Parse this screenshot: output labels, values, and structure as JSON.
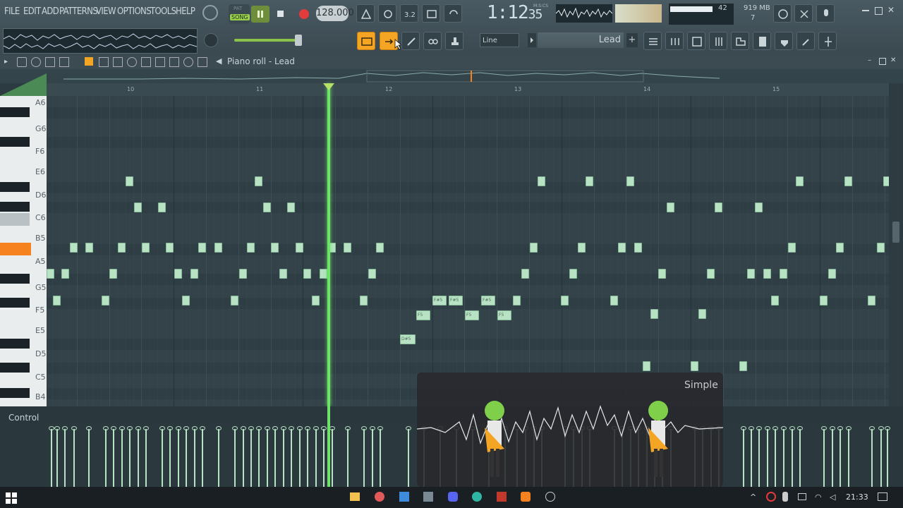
{
  "menu": {
    "items": [
      "FILE",
      "EDIT",
      "ADD",
      "PATTERNS",
      "VIEW",
      "OPTIONS",
      "TOOLS",
      "HELP"
    ]
  },
  "transport": {
    "mode_pat": "PAT",
    "mode_song": "SONG",
    "tempo": "128.000",
    "time_main": "1:12",
    "time_sub": "35",
    "time_unit": "M:S:CS"
  },
  "cpu": {
    "value": "42",
    "memory": "919 MB",
    "voices": "7"
  },
  "toolbar": {
    "snap": "Line",
    "pattern": "Lead",
    "add": "+"
  },
  "piano_roll": {
    "title": "Piano roll - Lead",
    "bars": [
      "10",
      "11",
      "12",
      "13",
      "14",
      "15"
    ],
    "key_labels": [
      "A6",
      "G6",
      "F6",
      "E6",
      "D6",
      "C6",
      "B5",
      "A5",
      "G5",
      "F5",
      "E5",
      "D5",
      "C5",
      "B4"
    ],
    "note_labels": {
      "fs5": "F#5",
      "f5": "F5",
      "ds5": "D#5"
    }
  },
  "control": {
    "label": "Control"
  },
  "overlay": {
    "title": "Simple"
  },
  "taskbar": {
    "clock": "21:33"
  },
  "colors": {
    "note": "#b7e2c4",
    "playhead": "#6ee36a",
    "accent": "#f5821f"
  }
}
